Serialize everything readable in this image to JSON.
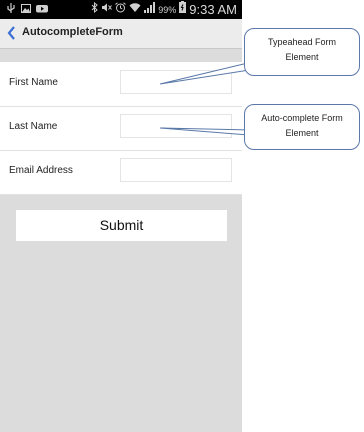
{
  "status_bar": {
    "left_icons": [
      "usb-icon",
      "image-icon",
      "youtube-icon"
    ],
    "right_icons": [
      "bluetooth-icon",
      "mute-icon",
      "alarm-icon",
      "wifi-icon",
      "signal-icon",
      "battery-icon"
    ],
    "battery": "99%",
    "time": "9:33 AM"
  },
  "action_bar": {
    "title": "AutocompleteForm"
  },
  "form": {
    "fields": [
      {
        "label": "First Name",
        "value": ""
      },
      {
        "label": "Last Name",
        "value": ""
      },
      {
        "label": "Email Address",
        "value": ""
      }
    ],
    "submit_label": "Submit"
  },
  "callouts": [
    {
      "line1": "Typeahead Form",
      "line2": "Element"
    },
    {
      "line1": "Auto-complete Form",
      "line2": "Element"
    }
  ],
  "colors": {
    "status_bar": "#000000",
    "action_bar": "#ececec",
    "accent": "#3b6fd6",
    "screen_background": "#dcdcdc",
    "callout_border": "#5a79a8"
  }
}
